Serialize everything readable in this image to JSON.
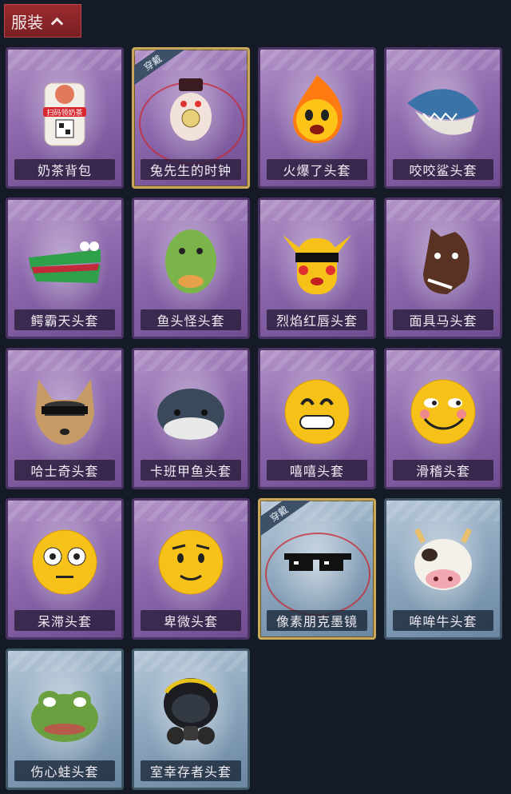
{
  "header": {
    "title": "服装"
  },
  "equipped_tag": "穿戴",
  "qr_text": "扫码领奶茶",
  "items": [
    {
      "label": "奶茶背包",
      "tone": "purple",
      "icon": "milk-tea-backpack-icon"
    },
    {
      "label": "兔先生的时钟",
      "tone": "purple",
      "icon": "rabbit-clock-icon",
      "equipped": true
    },
    {
      "label": "火爆了头套",
      "tone": "purple",
      "icon": "fire-head-icon"
    },
    {
      "label": "咬咬鲨头套",
      "tone": "purple",
      "icon": "shark-head-icon"
    },
    {
      "label": "鳄霸天头套",
      "tone": "purple",
      "icon": "crocodile-head-icon"
    },
    {
      "label": "鱼头怪头套",
      "tone": "purple",
      "icon": "fish-head-icon"
    },
    {
      "label": "烈焰红唇头套",
      "tone": "purple",
      "icon": "red-lips-head-icon"
    },
    {
      "label": "面具马头套",
      "tone": "purple",
      "icon": "horse-mask-icon"
    },
    {
      "label": "哈士奇头套",
      "tone": "purple",
      "icon": "husky-head-icon"
    },
    {
      "label": "卡班甲鱼头套",
      "tone": "purple",
      "icon": "turtle-head-icon"
    },
    {
      "label": "嘻嘻头套",
      "tone": "purple",
      "icon": "grin-emoji-icon"
    },
    {
      "label": "滑稽头套",
      "tone": "purple",
      "icon": "funny-emoji-icon"
    },
    {
      "label": "呆滞头套",
      "tone": "purple",
      "icon": "flushed-emoji-icon"
    },
    {
      "label": "卑微头套",
      "tone": "purple",
      "icon": "pleading-emoji-icon"
    },
    {
      "label": "像素朋克墨镜",
      "tone": "blue",
      "icon": "pixel-sunglasses-icon",
      "equipped": true
    },
    {
      "label": "哞哞牛头套",
      "tone": "blue",
      "icon": "cow-head-icon"
    },
    {
      "label": "伤心蛙头套",
      "tone": "blue",
      "icon": "sad-frog-icon"
    },
    {
      "label": "室幸存者头套",
      "tone": "blue",
      "icon": "gas-mask-helmet-icon"
    }
  ]
}
